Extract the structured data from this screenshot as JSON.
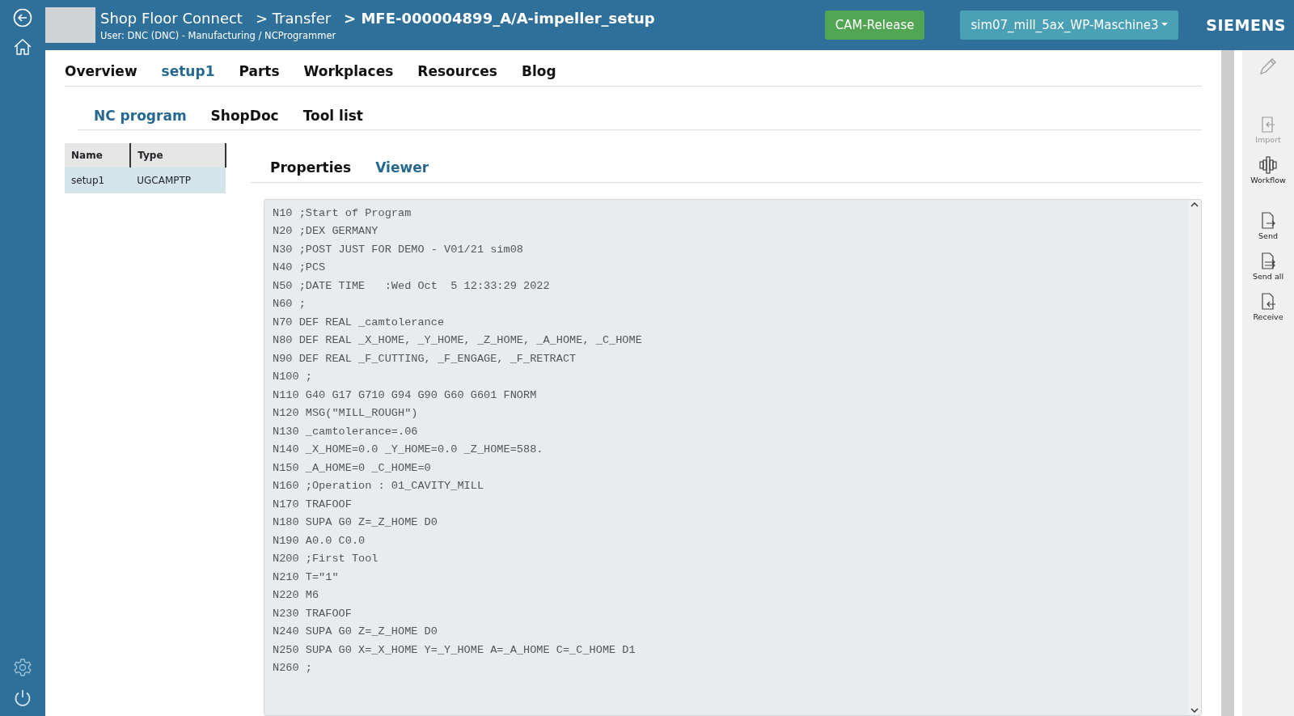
{
  "header": {
    "app_title": "Shop Floor Connect",
    "breadcrumb": [
      "> Transfer",
      "> MFE-000004899_A/A-impeller_setup"
    ],
    "user": "User: DNC (DNC) - Manufacturing / NCProgrammer",
    "release_button": "CAM-Release",
    "machine_dropdown": "sim07_mill_5ax_WP-Maschine3",
    "brand": "SIEMENS"
  },
  "main_tabs": [
    {
      "label": "Overview",
      "selected": false
    },
    {
      "label": "setup1",
      "selected": true
    },
    {
      "label": "Parts",
      "selected": false
    },
    {
      "label": "Workplaces",
      "selected": false
    },
    {
      "label": "Resources",
      "selected": false
    },
    {
      "label": "Blog",
      "selected": false
    }
  ],
  "sub_tabs": [
    {
      "label": "NC program",
      "selected": true
    },
    {
      "label": "ShopDoc",
      "selected": false
    },
    {
      "label": "Tool list",
      "selected": false
    }
  ],
  "table": {
    "columns": [
      "Name",
      "Type"
    ],
    "rows": [
      {
        "cells": [
          "setup1",
          "UGCAMPTP"
        ],
        "selected": true
      }
    ]
  },
  "viewer_tabs": [
    {
      "label": "Properties",
      "selected": false
    },
    {
      "label": "Viewer",
      "selected": true
    }
  ],
  "code_lines": [
    "N10 ;Start of Program",
    "N20 ;DEX GERMANY",
    "N30 ;POST JUST FOR DEMO - V01/21 sim08",
    "N40 ;PCS",
    "N50 ;DATE TIME   :Wed Oct  5 12:33:29 2022",
    "N60 ;",
    "N70 DEF REAL _camtolerance",
    "N80 DEF REAL _X_HOME, _Y_HOME, _Z_HOME, _A_HOME, _C_HOME",
    "N90 DEF REAL _F_CUTTING, _F_ENGAGE, _F_RETRACT",
    "N100 ;",
    "N110 G40 G17 G710 G94 G90 G60 G601 FNORM",
    "N120 MSG(\"MILL_ROUGH\")",
    "N130 _camtolerance=.06",
    "N140 _X_HOME=0.0 _Y_HOME=0.0 _Z_HOME=588.",
    "N150 _A_HOME=0 _C_HOME=0",
    "N160 ;Operation : 01_CAVITY_MILL",
    "N170 TRAFOOF",
    "N180 SUPA G0 Z=_Z_HOME D0",
    "N190 A0.0 C0.0",
    "N200 ;First Tool",
    "N210 T=\"1\"",
    "N220 M6",
    "N230 TRAFOOF",
    "N240 SUPA G0 Z=_Z_HOME D0",
    "N250 SUPA G0 X=_X_HOME Y=_Y_HOME A=_A_HOME C=_C_HOME D1",
    "N260 ;"
  ],
  "side_actions": [
    {
      "kind": "import",
      "label": "Import",
      "disabled": true
    },
    {
      "kind": "workflow",
      "label": "Workflow",
      "disabled": false
    },
    {
      "kind": "send",
      "label": "Send",
      "disabled": false
    },
    {
      "kind": "sendall",
      "label": "Send all",
      "disabled": false
    },
    {
      "kind": "receive",
      "label": "Receive",
      "disabled": false
    }
  ]
}
